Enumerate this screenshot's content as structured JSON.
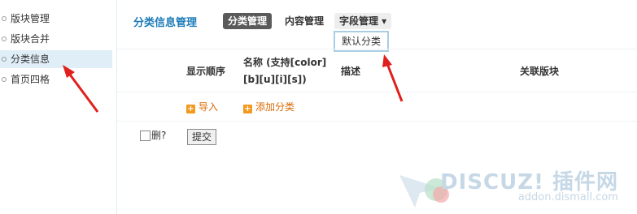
{
  "sidebar": {
    "items": [
      {
        "label": "版块管理"
      },
      {
        "label": "版块合并"
      },
      {
        "label": "分类信息",
        "active": true
      },
      {
        "label": "首页四格"
      }
    ]
  },
  "header": {
    "title": "分类信息管理",
    "tabs": [
      {
        "label": "分类管理",
        "active": true
      },
      {
        "label": "内容管理"
      },
      {
        "label": "字段管理 ▾"
      }
    ],
    "dropdown_item": "默认分类"
  },
  "table": {
    "columns": [
      "显示顺序",
      "名称 (支持[color]",
      "[b][u][i][s])",
      "描述",
      "关联版块"
    ]
  },
  "actions": {
    "import_label": "导入",
    "add_category_label": "添加分类"
  },
  "footer": {
    "delete_label": "删?",
    "submit_label": "提交"
  },
  "watermark": {
    "title": "DISCUZ! 插件网",
    "subtitle": "addon.dismall.com"
  },
  "colors": {
    "accent": "#1e7bb8",
    "annotation": "#e0201c",
    "link": "#d86a00"
  }
}
